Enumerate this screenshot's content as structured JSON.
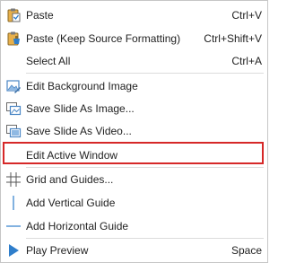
{
  "menu": {
    "items": [
      {
        "label": "Paste",
        "shortcut": "Ctrl+V",
        "icon": "paste-icon"
      },
      {
        "label": "Paste (Keep Source Formatting)",
        "shortcut": "Ctrl+Shift+V",
        "icon": "paste-keep-formatting-icon"
      },
      {
        "label": "Select All",
        "shortcut": "Ctrl+A",
        "icon": ""
      },
      {
        "label": "Edit Background Image",
        "shortcut": "",
        "icon": "edit-background-image-icon"
      },
      {
        "label": "Save Slide As Image...",
        "shortcut": "",
        "icon": "save-slide-image-icon"
      },
      {
        "label": "Save Slide As Video...",
        "shortcut": "",
        "icon": "save-slide-video-icon"
      },
      {
        "label": "Edit Active Window",
        "shortcut": "",
        "icon": ""
      },
      {
        "label": "Grid and Guides...",
        "shortcut": "",
        "icon": "grid-icon"
      },
      {
        "label": "Add Vertical Guide",
        "shortcut": "",
        "icon": "vertical-guide-icon"
      },
      {
        "label": "Add Horizontal Guide",
        "shortcut": "",
        "icon": "horizontal-guide-icon"
      },
      {
        "label": "Play Preview",
        "shortcut": "Space",
        "icon": "play-icon"
      }
    ],
    "highlight_color": "#d62828",
    "accent_color": "#2f7ecb"
  }
}
